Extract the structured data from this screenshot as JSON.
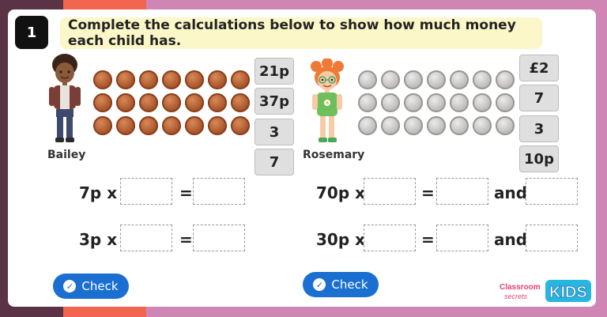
{
  "question_number": "1",
  "instruction": "Complete the calculations below to show how much money each child has.",
  "left": {
    "child_name": "Bailey",
    "coins": {
      "type": "1p-copper",
      "rows": 3,
      "cols": 7
    },
    "options": [
      "21p",
      "37p",
      "3",
      "7"
    ],
    "rows": [
      {
        "label": "7p x",
        "equals": "="
      },
      {
        "label": "3p x",
        "equals": "="
      }
    ],
    "check_label": "Check"
  },
  "right": {
    "child_name": "Rosemary",
    "coins": {
      "type": "10p-silver",
      "rows": 3,
      "cols": 7
    },
    "options": [
      "£2",
      "7",
      "3",
      "10p"
    ],
    "rows": [
      {
        "label": "70p x",
        "equals": "=",
        "and": "and"
      },
      {
        "label": "30p x",
        "equals": "=",
        "and": "and"
      }
    ],
    "check_label": "Check"
  },
  "logo": {
    "top": "Classroom",
    "bottom": "secrets",
    "kids": "KIDS"
  },
  "colors": {
    "check_blue": "#1a6fd1",
    "instruction_bg": "#fbf7c9",
    "frame_pink": "#cf86b5"
  }
}
